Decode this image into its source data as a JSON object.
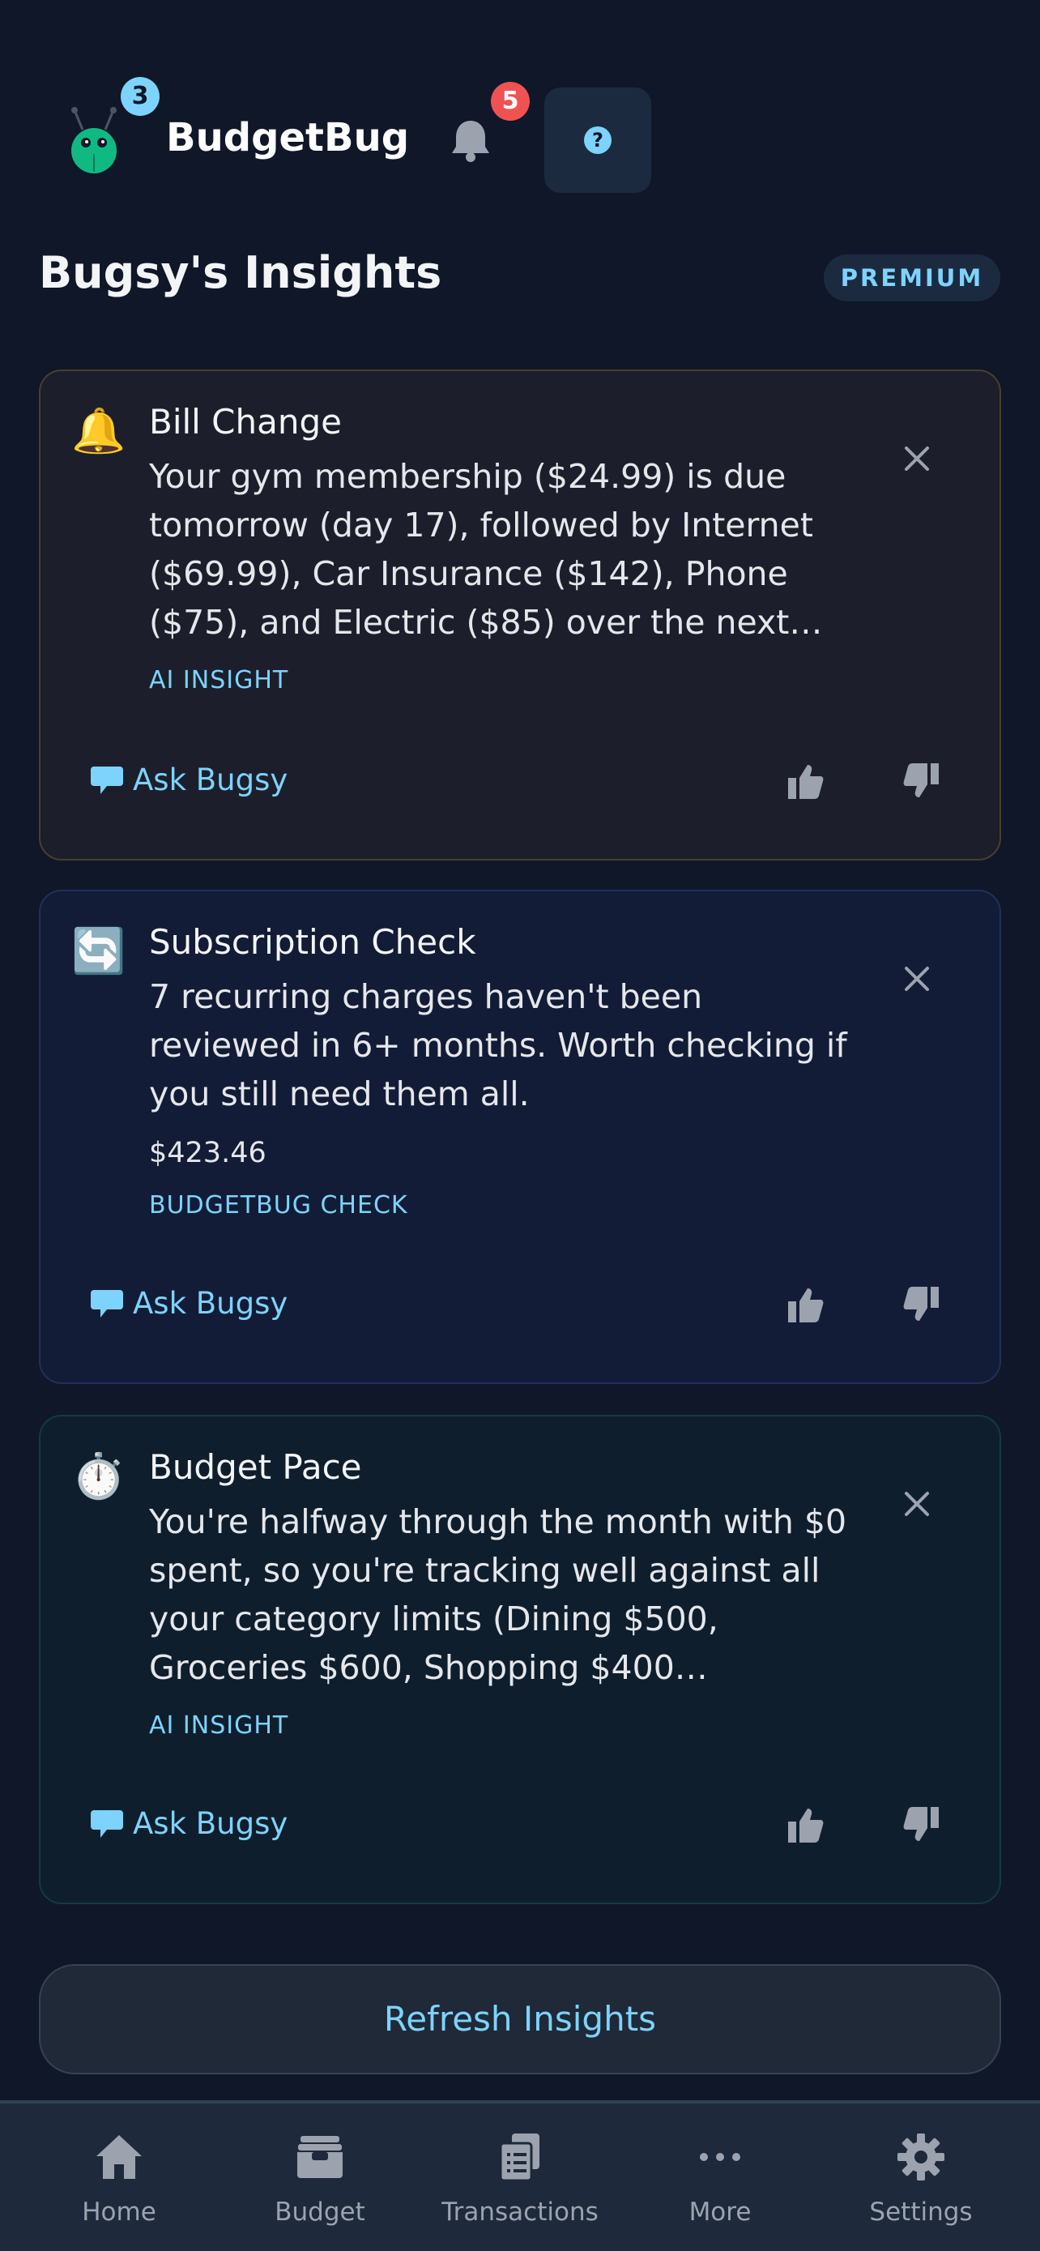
{
  "header": {
    "brand": "BudgetBug",
    "logo_badge_count": "3",
    "notification_count": "5",
    "logo_icon": "bug-icon",
    "bell_icon": "bell-icon",
    "help_icon": "question-icon"
  },
  "page": {
    "title": "Bugsy's Insights",
    "badge": "PREMIUM"
  },
  "cards": [
    {
      "icon": "🔔",
      "title": "Bill Change",
      "body": "Your gym membership ($24.99) is due tomorrow (day 17), followed by Internet ($69.99), Car Insurance ($142), Phone ($75), and Electric ($85) over the next…",
      "tag": "AI INSIGHT",
      "ask": "Ask Bugsy"
    },
    {
      "icon": "🔄",
      "title": "Subscription Check",
      "body": "7 recurring charges haven't been reviewed in 6+ months. Worth checking if you still need them all.",
      "amount": "$423.46",
      "tag": "BUDGETBUG CHECK",
      "ask": "Ask Bugsy"
    },
    {
      "icon": "⏱️",
      "title": "Budget Pace",
      "body": "You're halfway through the month with $0 spent, so you're tracking well against all your category limits (Dining $500, Groceries $600, Shopping $400…",
      "tag": "AI INSIGHT",
      "ask": "Ask Bugsy"
    }
  ],
  "refresh_label": "Refresh Insights",
  "nav": [
    {
      "label": "Home",
      "icon": "home-icon"
    },
    {
      "label": "Budget",
      "icon": "wallet-icon"
    },
    {
      "label": "Transactions",
      "icon": "receipts-icon"
    },
    {
      "label": "More",
      "icon": "ellipsis-icon"
    },
    {
      "label": "Settings",
      "icon": "gear-icon"
    }
  ],
  "colors": {
    "background": "#0f1729",
    "accent": "#7dd3fc",
    "badge_red": "#f05252",
    "nav_bg": "#1e293b"
  }
}
